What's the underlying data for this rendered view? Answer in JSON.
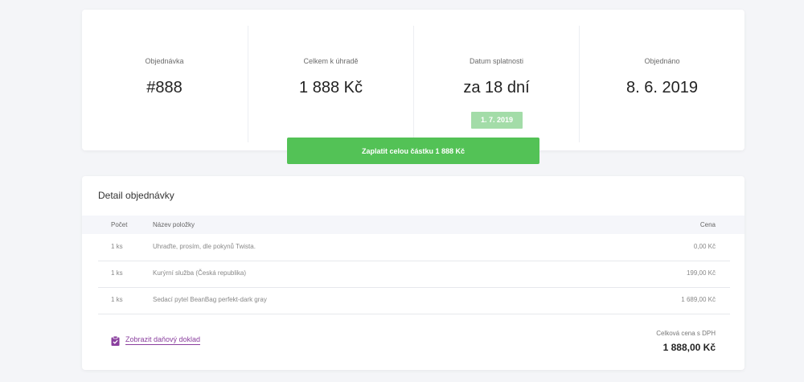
{
  "summary": {
    "order": {
      "label": "Objednávka",
      "value": "#888"
    },
    "total": {
      "label": "Celkem k úhradě",
      "value": "1 888 Kč"
    },
    "due": {
      "label": "Datum splatnosti",
      "value": "za 18 dní",
      "badge": "1. 7. 2019"
    },
    "ordered": {
      "label": "Objednáno",
      "value": "8. 6. 2019"
    }
  },
  "pay_button": {
    "label": "Zaplatit celou částku 1 888 Kč"
  },
  "detail": {
    "title": "Detail objednávky",
    "columns": {
      "qty": "Počet",
      "name": "Název položky",
      "price": "Cena"
    },
    "rows": [
      {
        "qty": "1 ks",
        "name": "Uhraďte, prosím, dle pokynů Twista.",
        "price": "0,00 Kč"
      },
      {
        "qty": "1 ks",
        "name": "Kurýrní služba (Česká republika)",
        "price": "199,00 Kč"
      },
      {
        "qty": "1 ks",
        "name": "Sedací pytel BeanBag perfekt-dark gray",
        "price": "1 689,00 Kč"
      }
    ],
    "invoice_link": "Zobrazit daňový doklad",
    "total_label": "Celková cena s DPH",
    "total_value": "1 888,00 Kč"
  },
  "colors": {
    "accent_green": "#53c256",
    "badge_green": "#a3dca8",
    "link_purple": "#8a3f9e",
    "background": "#f4f5f8"
  },
  "icons": {
    "invoice": "clipboard-check-icon"
  }
}
